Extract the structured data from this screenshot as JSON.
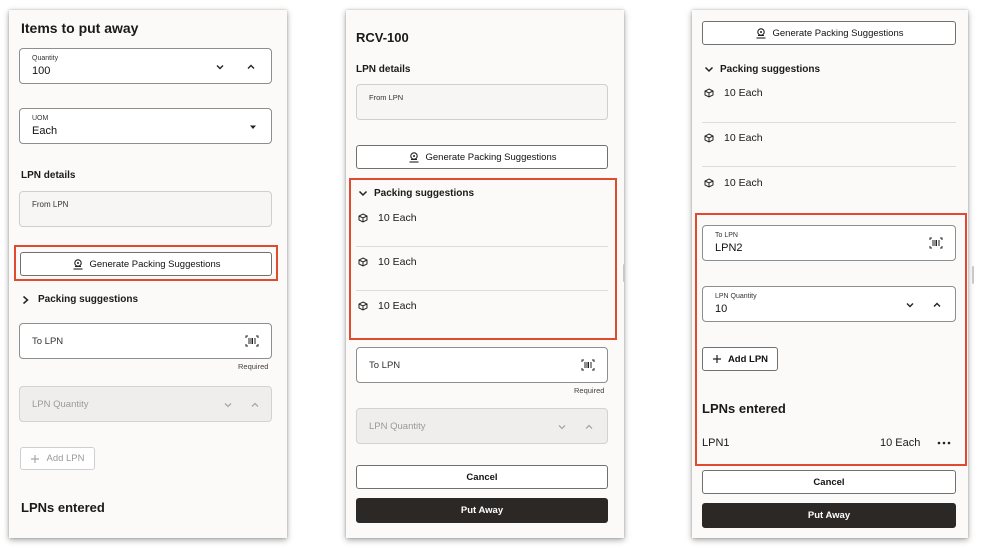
{
  "panel1": {
    "title": "Items to put away",
    "quantity": {
      "label": "Quantity",
      "value": "100"
    },
    "uom": {
      "label": "UOM",
      "value": "Each"
    },
    "lpn_details_label": "LPN details",
    "from_lpn_placeholder": "From LPN",
    "generate_button": "Generate Packing Suggestions",
    "packing_suggestions_label": "Packing suggestions",
    "to_lpn_placeholder": "To LPN",
    "required_text": "Required",
    "lpn_quantity_placeholder": "LPN Quantity",
    "add_lpn_button": "Add LPN",
    "lpns_entered_label": "LPNs entered"
  },
  "panel2": {
    "title": "RCV-100",
    "lpn_details_label": "LPN details",
    "from_lpn_placeholder": "From LPN",
    "generate_button": "Generate Packing Suggestions",
    "packing_suggestions_label": "Packing suggestions",
    "suggestions": [
      "10 Each",
      "10 Each",
      "10 Each"
    ],
    "to_lpn_placeholder": "To LPN",
    "required_text": "Required",
    "lpn_quantity_placeholder": "LPN Quantity",
    "cancel_button": "Cancel",
    "put_away_button": "Put Away"
  },
  "panel3": {
    "generate_button": "Generate Packing Suggestions",
    "packing_suggestions_label": "Packing suggestions",
    "suggestions": [
      "10 Each",
      "10 Each",
      "10 Each"
    ],
    "to_lpn": {
      "label": "To LPN",
      "value": "LPN2"
    },
    "lpn_quantity": {
      "label": "LPN Quantity",
      "value": "10"
    },
    "add_lpn_button": "Add LPN",
    "lpns_entered_label": "LPNs entered",
    "entered_row": {
      "name": "LPN1",
      "qty": "10 Each"
    },
    "cancel_button": "Cancel",
    "put_away_button": "Put Away"
  },
  "colors": {
    "highlight": "#e04a2e",
    "primary_button": "#2b2826"
  }
}
